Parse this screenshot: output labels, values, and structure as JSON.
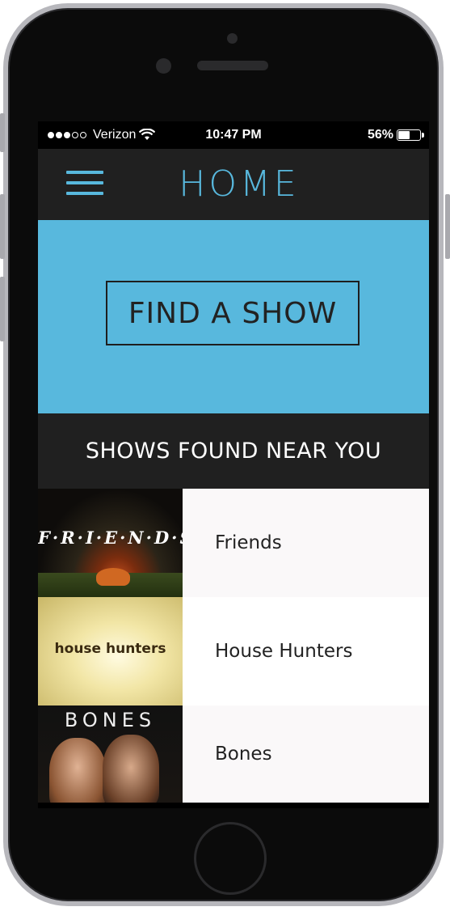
{
  "status_bar": {
    "carrier": "Verizon",
    "time": "10:47 PM",
    "battery": "56%",
    "battery_level": 0.56
  },
  "header": {
    "title": "HOME",
    "menu_icon": "hamburger-menu-icon"
  },
  "hero": {
    "button_label": "FIND A SHOW"
  },
  "section": {
    "title": "SHOWS FOUND NEAR YOU"
  },
  "shows": [
    {
      "name": "Friends",
      "thumb_title": "F·R·I·E·N·D·S"
    },
    {
      "name": "House Hunters",
      "thumb_title": "house hunters"
    },
    {
      "name": "Bones",
      "thumb_title": "BONES"
    }
  ],
  "colors": {
    "accent": "#58b8dd",
    "header_bg": "#202020"
  }
}
